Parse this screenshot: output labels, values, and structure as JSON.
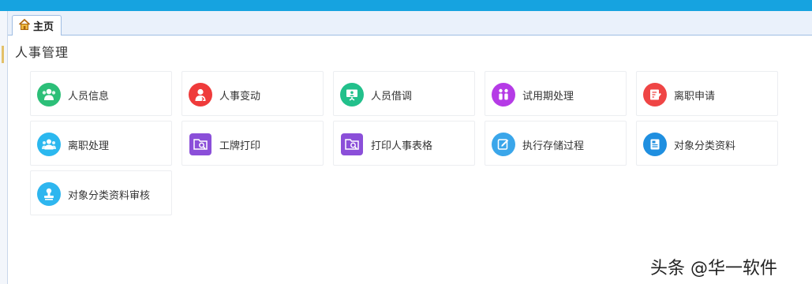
{
  "tabs": [
    {
      "label": "主页",
      "icon": "home-icon"
    }
  ],
  "section_title": "人事管理",
  "items": [
    {
      "label": "人员信息",
      "icon": "people-icon",
      "color": "#2cbf78"
    },
    {
      "label": "人事变动",
      "icon": "person-change-icon",
      "color": "#ef3b3b"
    },
    {
      "label": "人员借调",
      "icon": "presentation-icon",
      "color": "#22c08b"
    },
    {
      "label": "试用期处理",
      "icon": "probation-icon",
      "color": "#b53be6"
    },
    {
      "label": "离职申请",
      "icon": "document-edit-icon",
      "color": "#ef4545"
    },
    {
      "label": "离职处理",
      "icon": "group-icon",
      "color": "#2bb8ef"
    },
    {
      "label": "工牌打印",
      "icon": "folder-search-icon",
      "color": "#8b4fd9"
    },
    {
      "label": "打印人事表格",
      "icon": "folder-search-icon",
      "color": "#8b4fd9"
    },
    {
      "label": "执行存储过程",
      "icon": "edit-icon",
      "color": "#3aa6ea"
    },
    {
      "label": "对象分类资料",
      "icon": "document-icon",
      "color": "#1f8fe0"
    },
    {
      "label": "对象分类资料审核",
      "icon": "stamp-icon",
      "color": "#2eb6ef"
    }
  ],
  "watermark": "头条 @华一软件"
}
